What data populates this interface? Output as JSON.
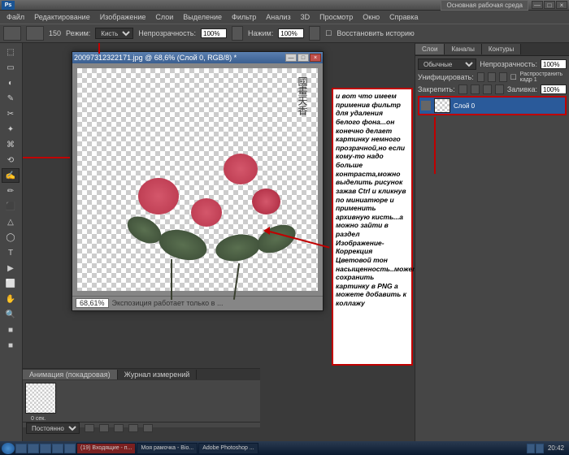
{
  "title_bar": {
    "workspace": "Основная рабочая среда"
  },
  "menu": [
    "Файл",
    "Редактирование",
    "Изображение",
    "Слои",
    "Выделение",
    "Фильтр",
    "Анализ",
    "3D",
    "Просмотр",
    "Окно",
    "Справка"
  ],
  "options": {
    "size_value": "150",
    "mode_label": "Режим:",
    "mode_value": "Кисть",
    "opacity_label": "Непрозрачность:",
    "opacity_value": "100%",
    "flow_label": "Нажим:",
    "flow_value": "100%",
    "restore_label": "Восстановить историю"
  },
  "document": {
    "title": "20097312322171.jpg @ 68,6% (Слой 0, RGB/8) *",
    "zoom": "68,61%",
    "status": "Экспозиция работает только в ...",
    "calligraphy": "國畫天香"
  },
  "annotation": "и вот что имеем применив фильтр для удаления белого фона...он конечно делает картинку  немного прозрачной,но если кому-то надо больше контраста,можно выделить  рисунок зажав Ctrl и кликнув по миниатюре и применить архивную кисть...а можно зайти в раздел Изображение-Коррекция Цветовой тон насыщенность..можете сохранить картинку в PNG а можете добавить к коллажу",
  "panels": {
    "layer_tabs": [
      "Слои",
      "Каналы",
      "Контуры"
    ],
    "blend_mode": "Обычные",
    "opacity_label": "Непрозрачность:",
    "opacity_value": "100%",
    "unif_label": "Унифицировать:",
    "spread_label": "Распространить кадр 1",
    "lock_label": "Закрепить:",
    "fill_label": "Заливка:",
    "fill_value": "100%",
    "layer0": "Слой 0"
  },
  "animation": {
    "tabs": [
      "Анимация (покадровая)",
      "Журнал измерений"
    ],
    "frame_time": "0 сек.",
    "loop": "Постоянно"
  },
  "taskbar": {
    "items": [
      "(19) Входящие - п...",
      "Моя рамочка - Bio...",
      "Adobe Photoshop ..."
    ],
    "clock": "20:42"
  }
}
